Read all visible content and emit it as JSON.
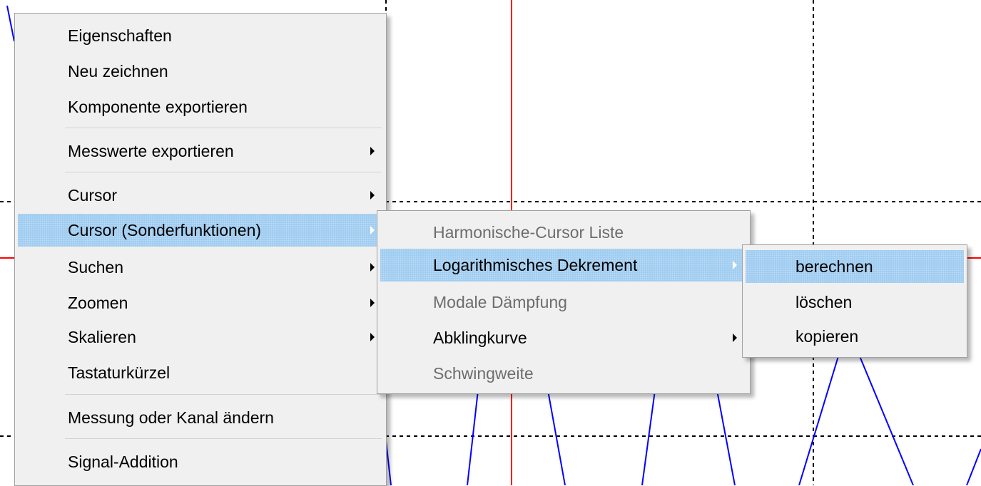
{
  "colors": {
    "menu_bg": "#f0f0f0",
    "highlight": "#99c9ef",
    "disabled_text": "#6d6d6d",
    "signal_line": "#0000ff",
    "cursor_line": "#ff0000",
    "grid_line": "#000000"
  },
  "context_menu": {
    "items": [
      {
        "label": "Eigenschaften"
      },
      {
        "label": "Neu zeichnen"
      },
      {
        "label": "Komponente exportieren"
      },
      {
        "label": "Messwerte exportieren",
        "submenu": true
      },
      {
        "label": "Cursor",
        "submenu": true
      },
      {
        "label": "Cursor (Sonderfunktionen)",
        "submenu": true,
        "highlighted": true
      },
      {
        "label": "Suchen",
        "submenu": true
      },
      {
        "label": "Zoomen",
        "submenu": true
      },
      {
        "label": "Skalieren",
        "submenu": true
      },
      {
        "label": "Tastaturkürzel"
      },
      {
        "label": "Messung oder Kanal ändern"
      },
      {
        "label": "Signal-Addition"
      }
    ]
  },
  "cursor_special_submenu": {
    "items": [
      {
        "label": "Harmonische-Cursor Liste",
        "disabled": true
      },
      {
        "label": "Logarithmisches Dekrement",
        "submenu": true,
        "highlighted": true
      },
      {
        "label": "Modale Dämpfung",
        "disabled": true
      },
      {
        "label": "Abklingkurve",
        "submenu": true
      },
      {
        "label": "Schwingweite",
        "disabled": true
      }
    ]
  },
  "log_decrement_submenu": {
    "items": [
      {
        "label": "berechnen",
        "highlighted": true
      },
      {
        "label": "löschen"
      },
      {
        "label": "kopieren"
      }
    ]
  }
}
